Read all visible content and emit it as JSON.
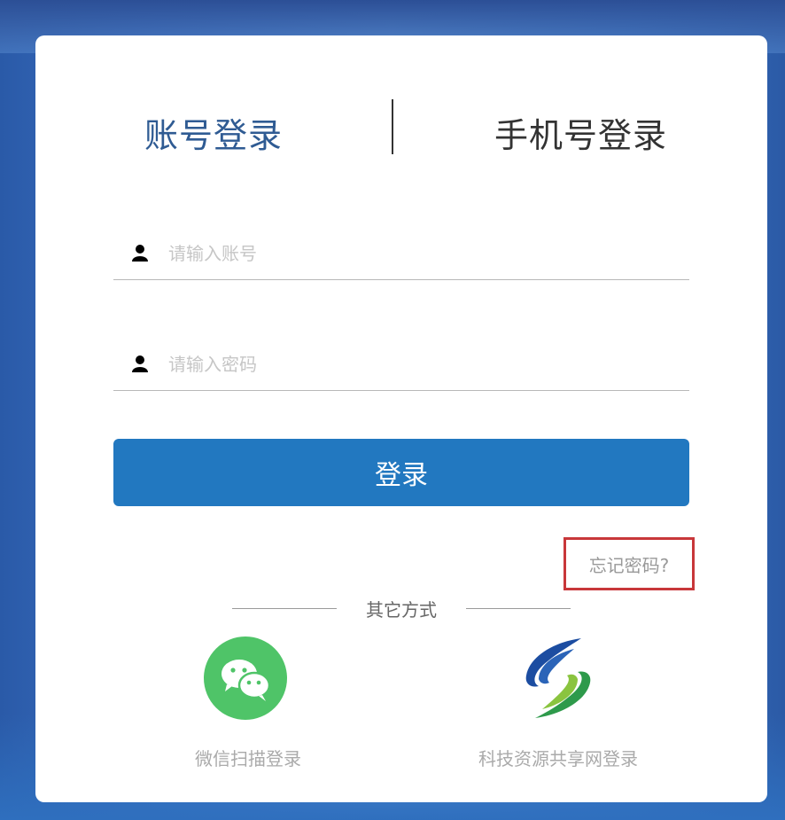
{
  "tabs": {
    "account_label": "账号登录",
    "phone_label": "手机号登录"
  },
  "form": {
    "account_placeholder": "请输入账号",
    "password_placeholder": "请输入密码",
    "login_label": "登录",
    "forgot_label": "忘记密码?"
  },
  "other": {
    "divider_label": "其它方式",
    "wechat_label": "微信扫描登录",
    "share_label": "科技资源共享网登录"
  },
  "icons": {
    "account": "user-icon",
    "password": "user-icon",
    "wechat": "wechat-icon",
    "share": "resource-share-logo"
  },
  "colors": {
    "accent": "#2278c0",
    "tab_active": "#2f5b93",
    "wechat": "#4fc468",
    "highlight": "#c8373a"
  }
}
